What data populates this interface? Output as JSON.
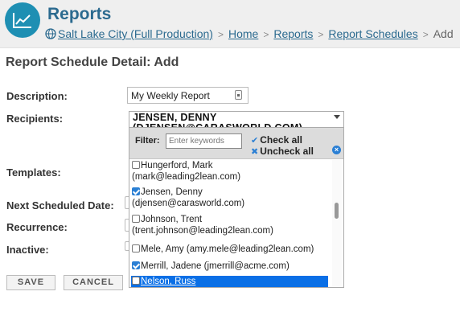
{
  "header": {
    "title": "Reports",
    "breadcrumb": [
      {
        "label": "Salt Lake City (Full Production)",
        "link": true
      },
      {
        "label": "Home",
        "link": true
      },
      {
        "label": "Report Schedules",
        "link": true
      }
    ],
    "breadcrumb_reports": "Reports",
    "breadcrumb_current": "Add",
    "separator": ">"
  },
  "page_title": "Report Schedule Detail: Add",
  "form": {
    "description_label": "Description:",
    "description_value": "My Weekly Report",
    "recipients_label": "Recipients:",
    "templates_label": "Templates:",
    "next_date_label": "Next Scheduled Date:",
    "recurrence_label": "Recurrence:",
    "inactive_label": "Inactive:"
  },
  "multiselect": {
    "selected_line1": "JENSEN, DENNY",
    "selected_line2": "(DJENSEN@CARASWORLD.COM),",
    "filter_label": "Filter:",
    "filter_placeholder": "Enter keywords",
    "check_all": "Check all",
    "uncheck_all": "Uncheck all",
    "items": [
      {
        "line1": "Hungerford, Mark",
        "line2": "(mark@leading2lean.com)",
        "checked": false
      },
      {
        "line1": "Jensen, Denny",
        "line2": "(djensen@carasworld.com)",
        "checked": true
      },
      {
        "line1": "Johnson, Trent",
        "line2": "(trent.johnson@leading2lean.com)",
        "checked": false
      },
      {
        "line1": "Mele, Amy (amy.mele@leading2lean.com)",
        "checked": false
      },
      {
        "line1": "Merrill, Jadene (jmerrill@acme.com)",
        "checked": true
      },
      {
        "line1": "Nelson, Russ",
        "checked": false,
        "highlighted": true
      }
    ]
  },
  "buttons": {
    "save": "SAVE",
    "cancel": "CANCEL"
  },
  "colors": {
    "brand": "#2b6a8f",
    "logo_bg": "#1e8fb3",
    "accent": "#2a7fd4",
    "highlight": "#0a6fe6"
  },
  "icons": [
    "chart-line-icon",
    "globe-icon",
    "calendar-icon",
    "check-icon",
    "x-icon",
    "close-icon",
    "chevron-down-icon"
  ]
}
